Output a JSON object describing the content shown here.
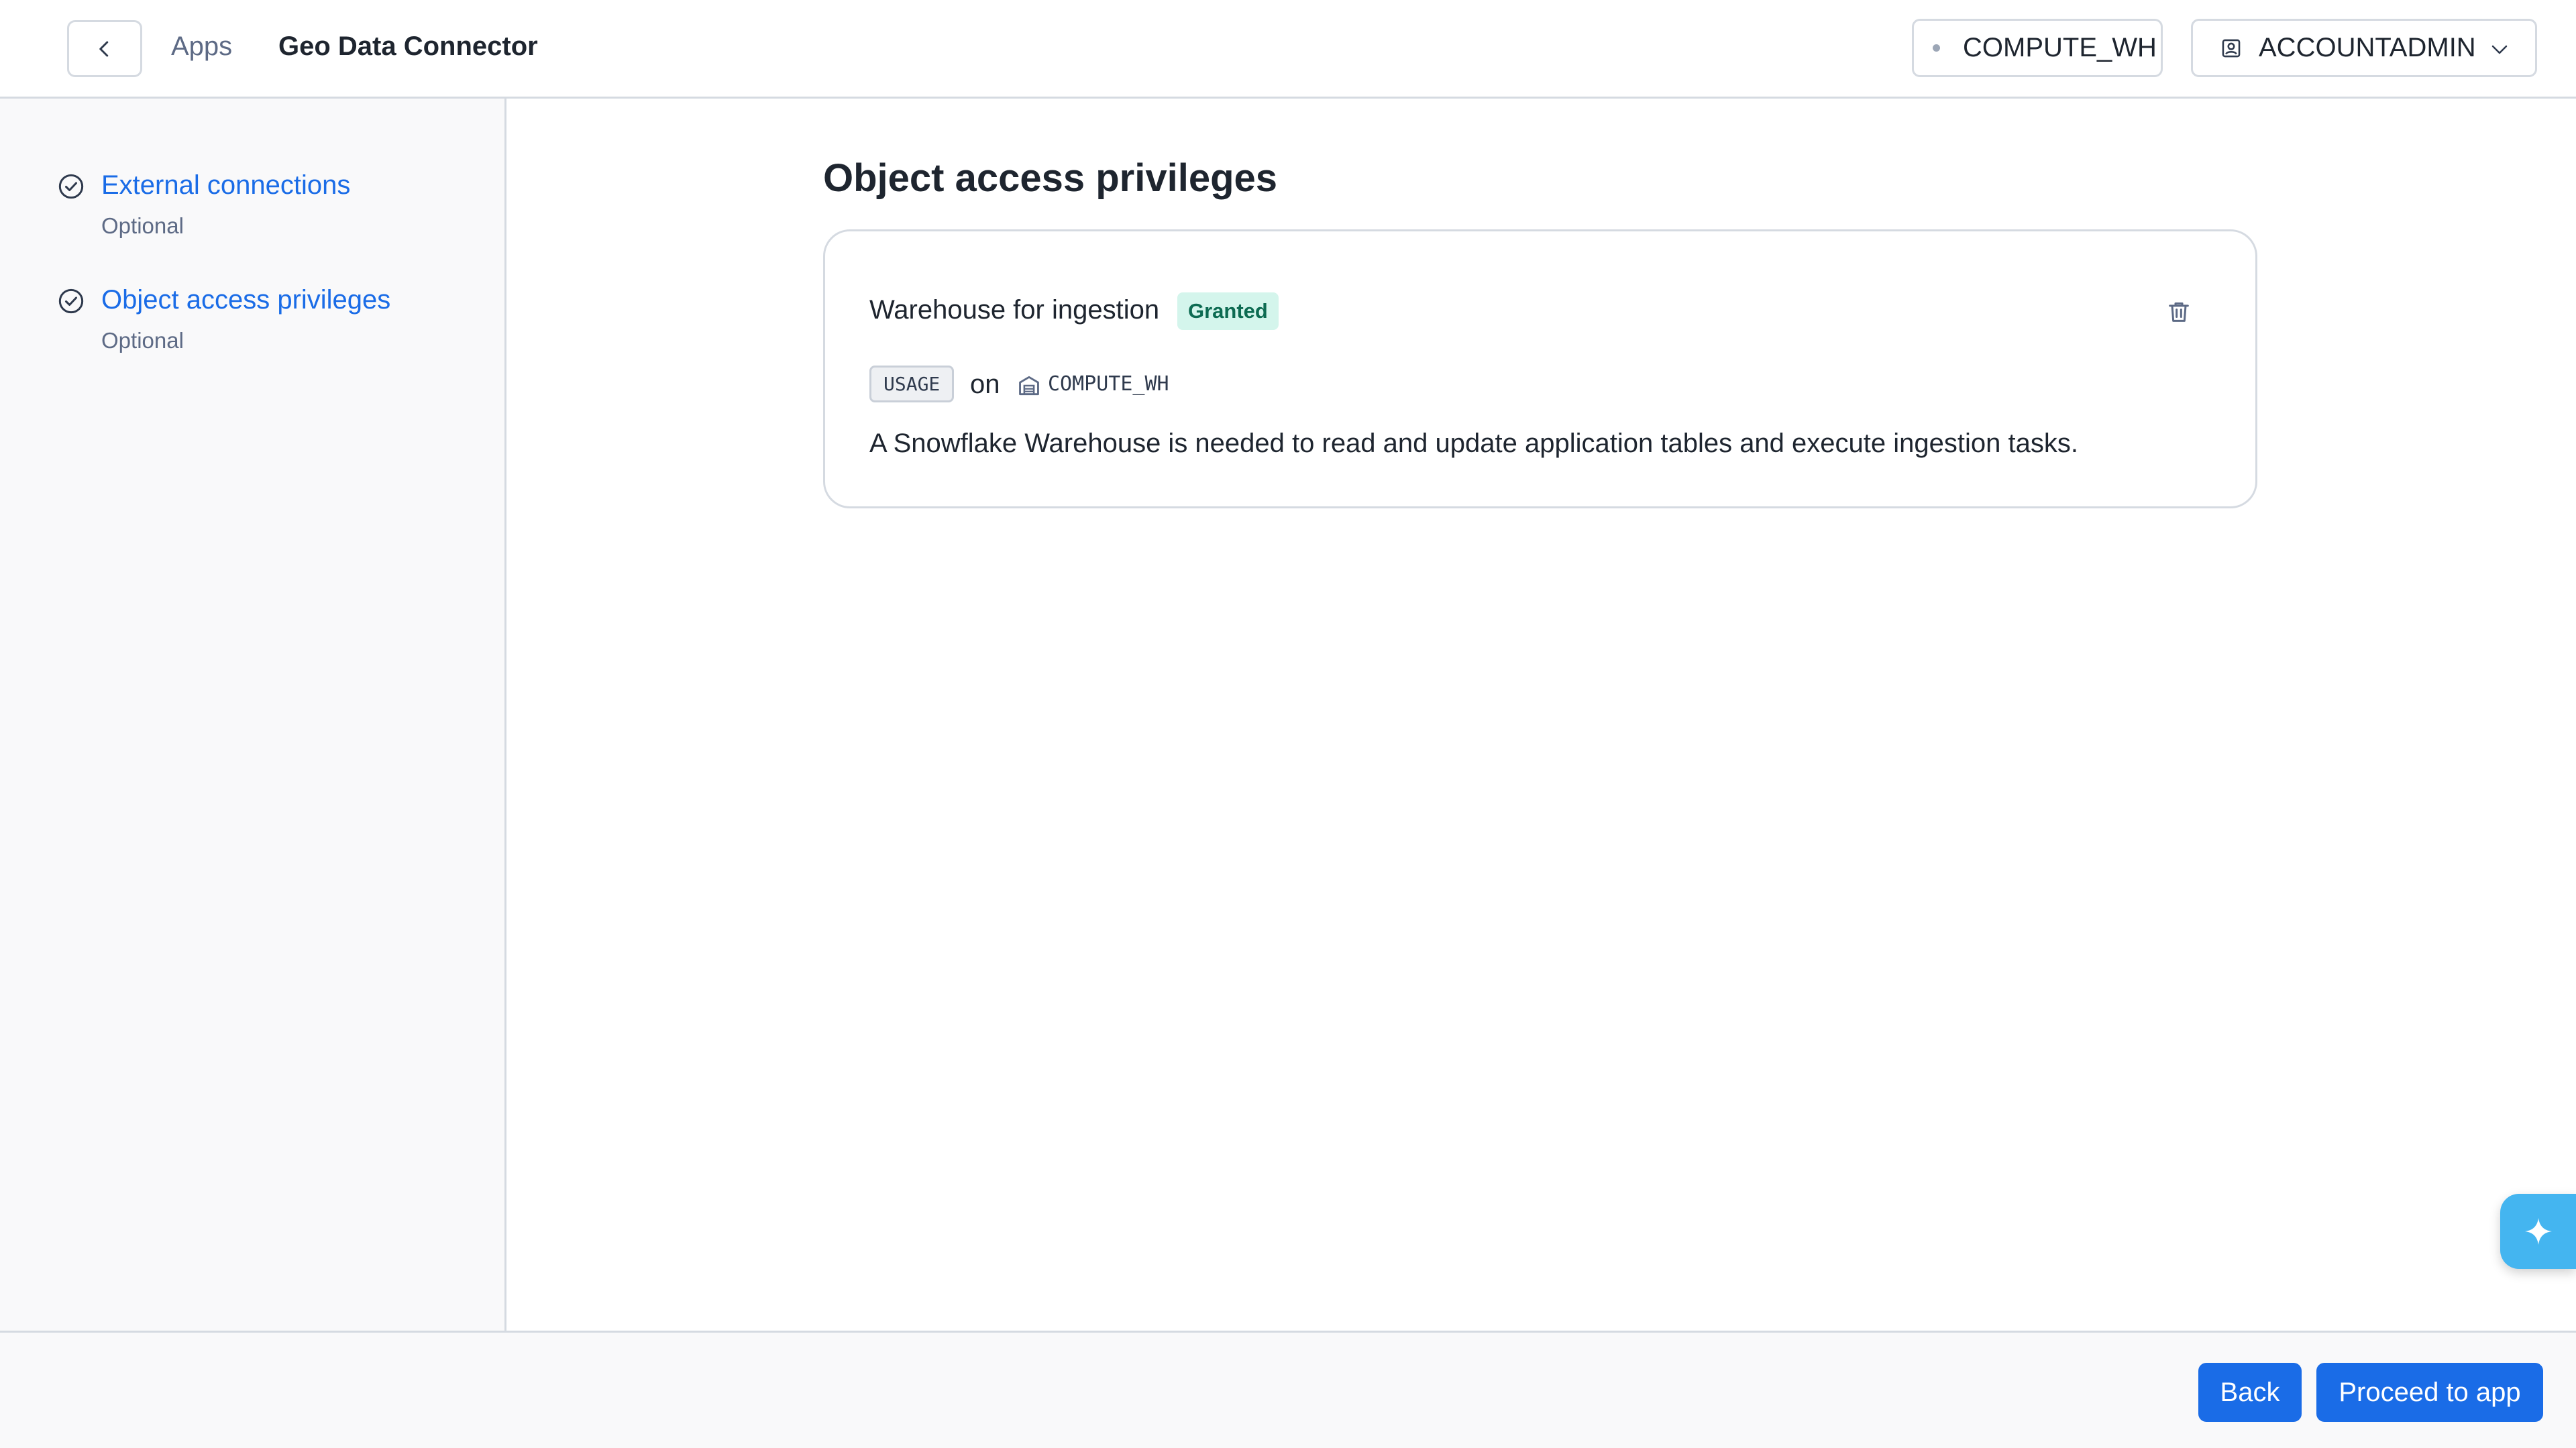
{
  "header": {
    "back_icon": "chevron-left-icon",
    "breadcrumb_apps": "Apps",
    "app_title": "Geo Data Connector",
    "warehouse": "COMPUTE_WH",
    "role": "ACCOUNTADMIN"
  },
  "sidebar": {
    "steps": [
      {
        "title": "External connections",
        "subtitle": "Optional",
        "icon": "check-circle-icon"
      },
      {
        "title": "Object access privileges",
        "subtitle": "Optional",
        "icon": "check-circle-icon"
      }
    ]
  },
  "main": {
    "title": "Object access privileges",
    "card": {
      "title": "Warehouse for ingestion",
      "status": "Granted",
      "privilege": "USAGE",
      "on_text": "on",
      "object_name": "COMPUTE_WH",
      "description": "A Snowflake Warehouse is needed to read and update application tables and execute ingestion tasks."
    }
  },
  "footer": {
    "back_label": "Back",
    "proceed_label": "Proceed to app"
  },
  "colors": {
    "accent": "#1a6ce7",
    "granted_bg": "#d4f5ec",
    "granted_text": "#0d6b52",
    "ai_button": "#44b5f0"
  }
}
